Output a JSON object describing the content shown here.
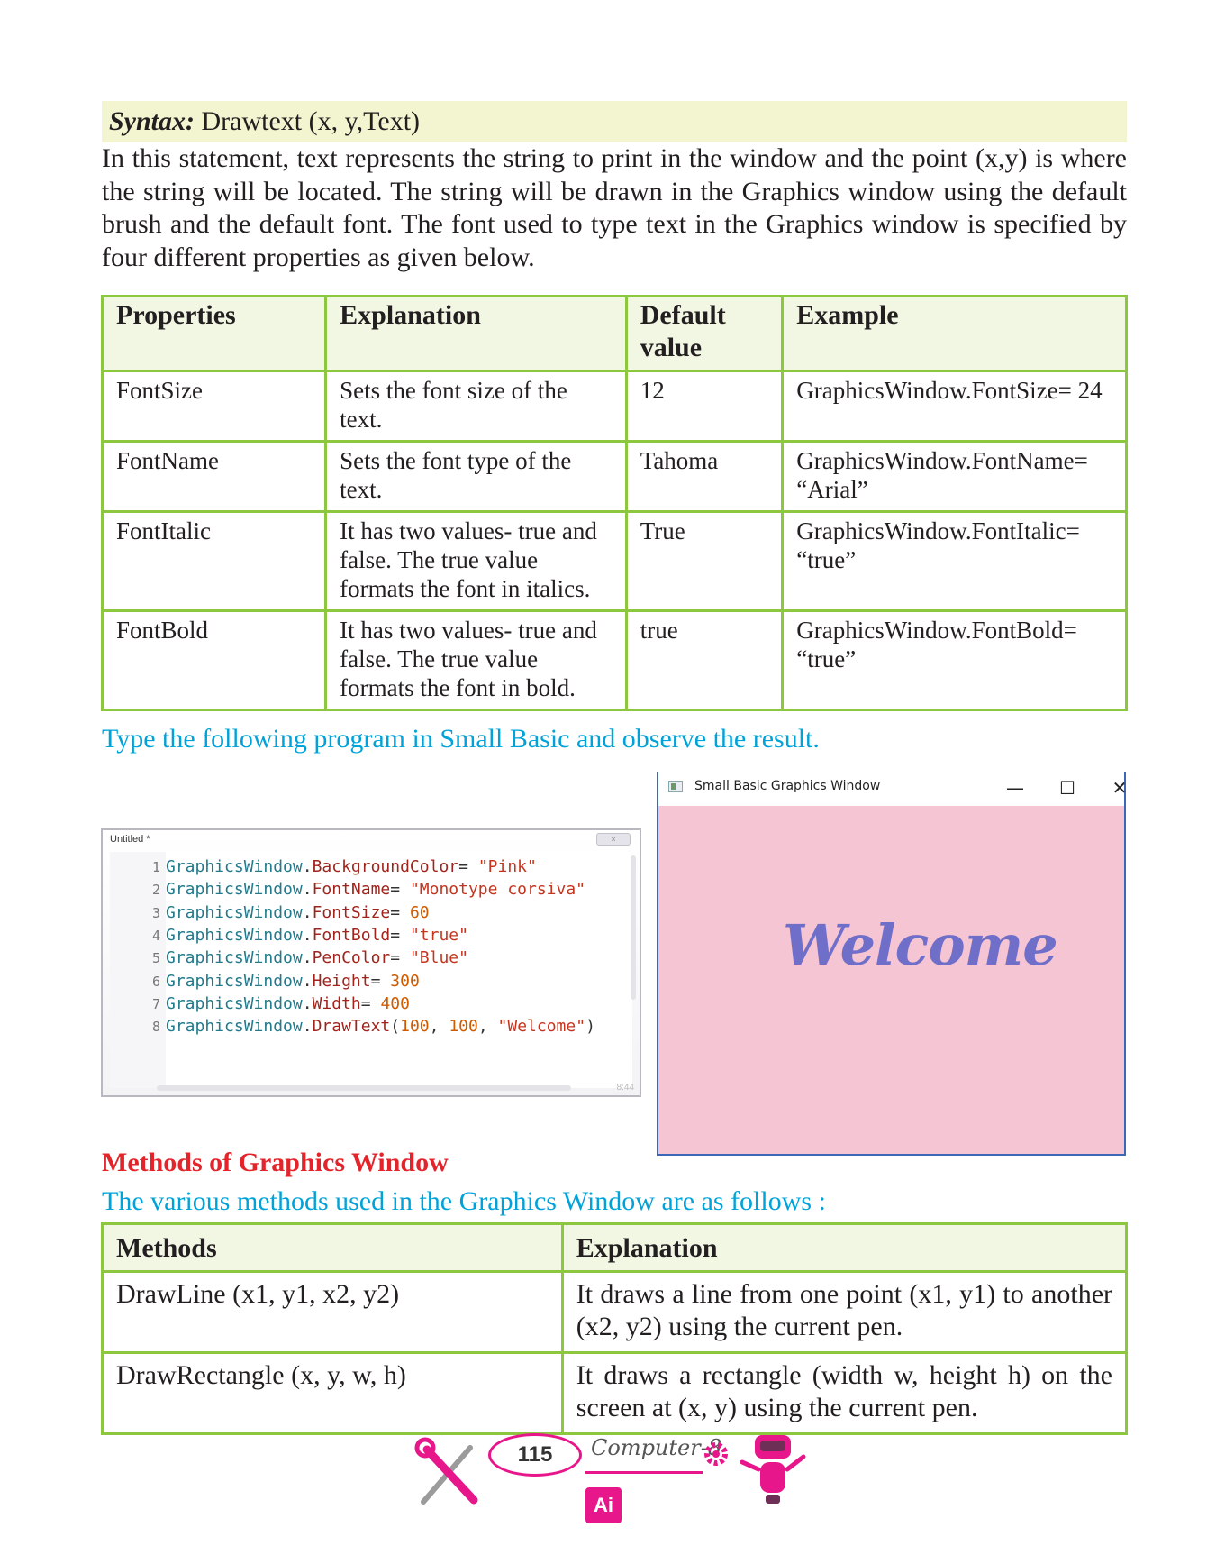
{
  "syntax": {
    "label": "Syntax:",
    "text": "Drawtext (x, y,Text)"
  },
  "intro": "In this statement, text represents the string to print in the window and the point (x,y) is where the string will be located. The string will be drawn in the Graphics window using the default brush and the default font. The font used to type text in the Graphics window is specified by four different properties as given below.",
  "properties_table": {
    "headers": [
      "Properties",
      "Explanation",
      "Default value",
      "Example"
    ],
    "rows": [
      [
        "FontSize",
        "Sets the font size of the text.",
        "12",
        "GraphicsWindow.FontSize= 24"
      ],
      [
        "FontName",
        "Sets the font type of the text.",
        "Tahoma",
        "GraphicsWindow.FontName= “Arial”"
      ],
      [
        "FontItalic",
        "It has two values- true and false. The true value formats the font in italics.",
        "True",
        "GraphicsWindow.FontItalic= “true”"
      ],
      [
        "FontBold",
        "It has two values- true and false. The true value formats the font in bold.",
        "true",
        "GraphicsWindow.FontBold= “true”"
      ]
    ]
  },
  "instruction": "Type the following program in Small Basic and observe the result.",
  "editor": {
    "title": "Untitled *",
    "close_label": "×",
    "position": "8:44",
    "lines": [
      {
        "n": "1",
        "obj": "GraphicsWindow",
        "mem": "BackgroundColor",
        "op": "= ",
        "args": [
          {
            "t": "str",
            "v": "\"Pink\""
          }
        ]
      },
      {
        "n": "2",
        "obj": "GraphicsWindow",
        "mem": "FontName",
        "op": "= ",
        "args": [
          {
            "t": "str",
            "v": "\"Monotype corsiva\""
          }
        ]
      },
      {
        "n": "3",
        "obj": "GraphicsWindow",
        "mem": "FontSize",
        "op": "= ",
        "args": [
          {
            "t": "num",
            "v": "60"
          }
        ]
      },
      {
        "n": "4",
        "obj": "GraphicsWindow",
        "mem": "FontBold",
        "op": "= ",
        "args": [
          {
            "t": "str",
            "v": "\"true\""
          }
        ]
      },
      {
        "n": "5",
        "obj": "GraphicsWindow",
        "mem": "PenColor",
        "op": "= ",
        "args": [
          {
            "t": "str",
            "v": "\"Blue\""
          }
        ]
      },
      {
        "n": "6",
        "obj": "GraphicsWindow",
        "mem": "Height",
        "op": "= ",
        "args": [
          {
            "t": "num",
            "v": "300"
          }
        ]
      },
      {
        "n": "7",
        "obj": "GraphicsWindow",
        "mem": "Width",
        "op": "= ",
        "args": [
          {
            "t": "num",
            "v": "400"
          }
        ]
      },
      {
        "n": "8",
        "obj": "GraphicsWindow",
        "mem": "DrawText",
        "op": "(",
        "args": [
          {
            "t": "num",
            "v": "100"
          },
          {
            "t": "pun",
            "v": ", "
          },
          {
            "t": "num",
            "v": "100"
          },
          {
            "t": "pun",
            "v": ", "
          },
          {
            "t": "str",
            "v": "\"Welcome\""
          },
          {
            "t": "pun",
            "v": ")"
          }
        ]
      }
    ]
  },
  "graphics_window": {
    "title": "Small Basic Graphics Window",
    "minimize": "—",
    "maximize": "☐",
    "close": "✕",
    "output_text": "Welcome",
    "background_color": "#f6c5d3",
    "text_color": "#6f6fc9"
  },
  "methods_heading": "Methods of Graphics Window",
  "methods_intro": "The various methods used in the Graphics Window are as follows :",
  "methods_table": {
    "headers": [
      "Methods",
      "Explanation"
    ],
    "rows": [
      [
        "DrawLine (x1, y1, x2, y2)",
        "It draws a line from one point (x1, y1) to another (x2, y2) using the current pen."
      ],
      [
        "DrawRectangle (x, y, w, h)",
        "It draws a rectangle (width w, height h) on the screen at (x, y) using the current pen."
      ]
    ]
  },
  "footer": {
    "page_number": "115",
    "book_title": "Computer-8",
    "badge": "Ai"
  },
  "colors": {
    "table_border": "#8dc63f",
    "cyan": "#00a3d9",
    "heading_red": "#e3242b",
    "accent_pink": "#e8168b"
  }
}
